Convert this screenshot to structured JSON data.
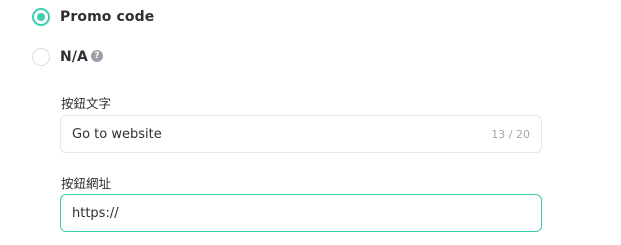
{
  "options": {
    "promo_code": {
      "label": "Promo code",
      "checked": true
    },
    "na": {
      "label": "N/A",
      "checked": false,
      "help_glyph": "?"
    }
  },
  "button_text_field": {
    "label": "按鈕文字",
    "value": "Go to website",
    "counter": "13 / 20"
  },
  "button_url_field": {
    "label": "按鈕網址",
    "value": "https://"
  },
  "colors": {
    "accent": "#3ccfae",
    "text": "#2d2f33",
    "muted": "#a3a8b0",
    "border": "#e3e6ea"
  },
  "icons": {
    "help": "help-circle-icon"
  }
}
